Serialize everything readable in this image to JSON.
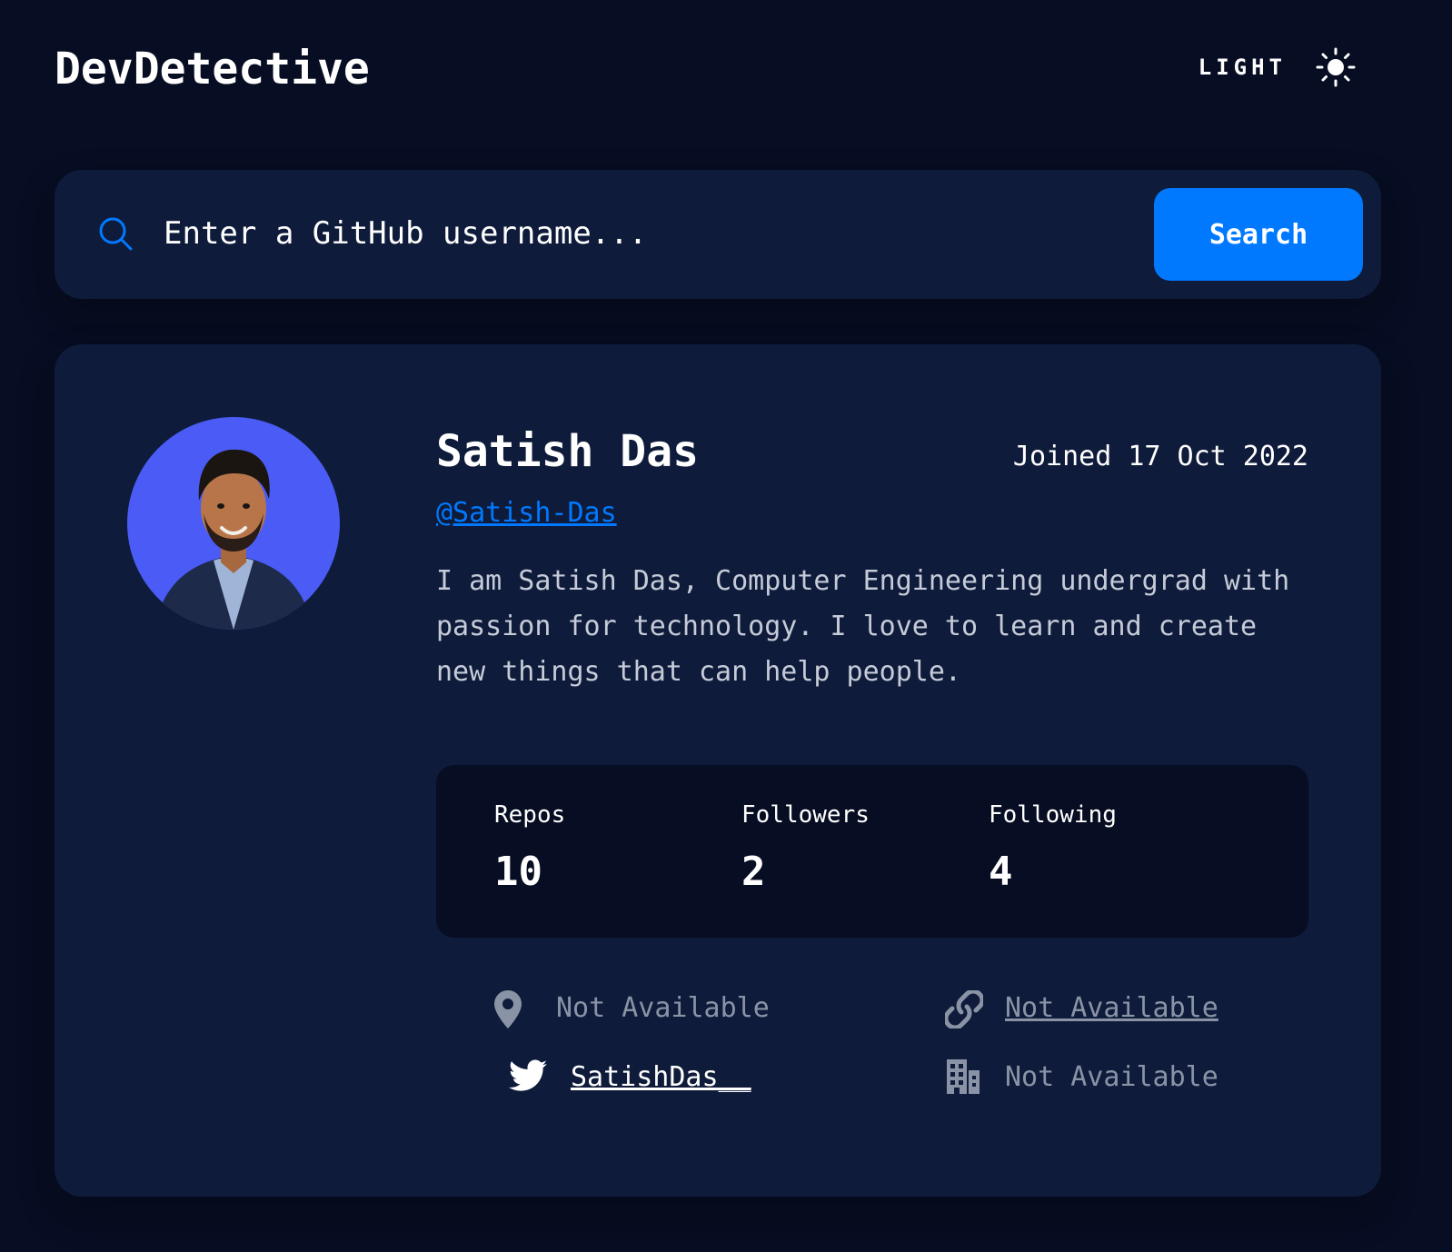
{
  "header": {
    "logo": "DevDetective",
    "theme_label": "LIGHT"
  },
  "search": {
    "placeholder": "Enter a GitHub username...",
    "button_label": "Search"
  },
  "profile": {
    "name": "Satish Das",
    "joined": "Joined 17 Oct 2022",
    "handle": "@Satish-Das",
    "bio": "I am Satish Das, Computer Engineering undergrad with passion for technology. I love to learn and create new things that can help people.",
    "stats": [
      {
        "label": "Repos",
        "value": "10"
      },
      {
        "label": "Followers",
        "value": "2"
      },
      {
        "label": "Following",
        "value": "4"
      }
    ],
    "links": {
      "location": "Not Available",
      "website": "Not Available",
      "twitter": "SatishDas__",
      "company": "Not Available"
    }
  },
  "colors": {
    "background": "#070d22",
    "card": "#0f1b3a",
    "accent": "#0079ff",
    "avatar_bg": "#4a5cf5",
    "muted": "#8a93a6"
  }
}
